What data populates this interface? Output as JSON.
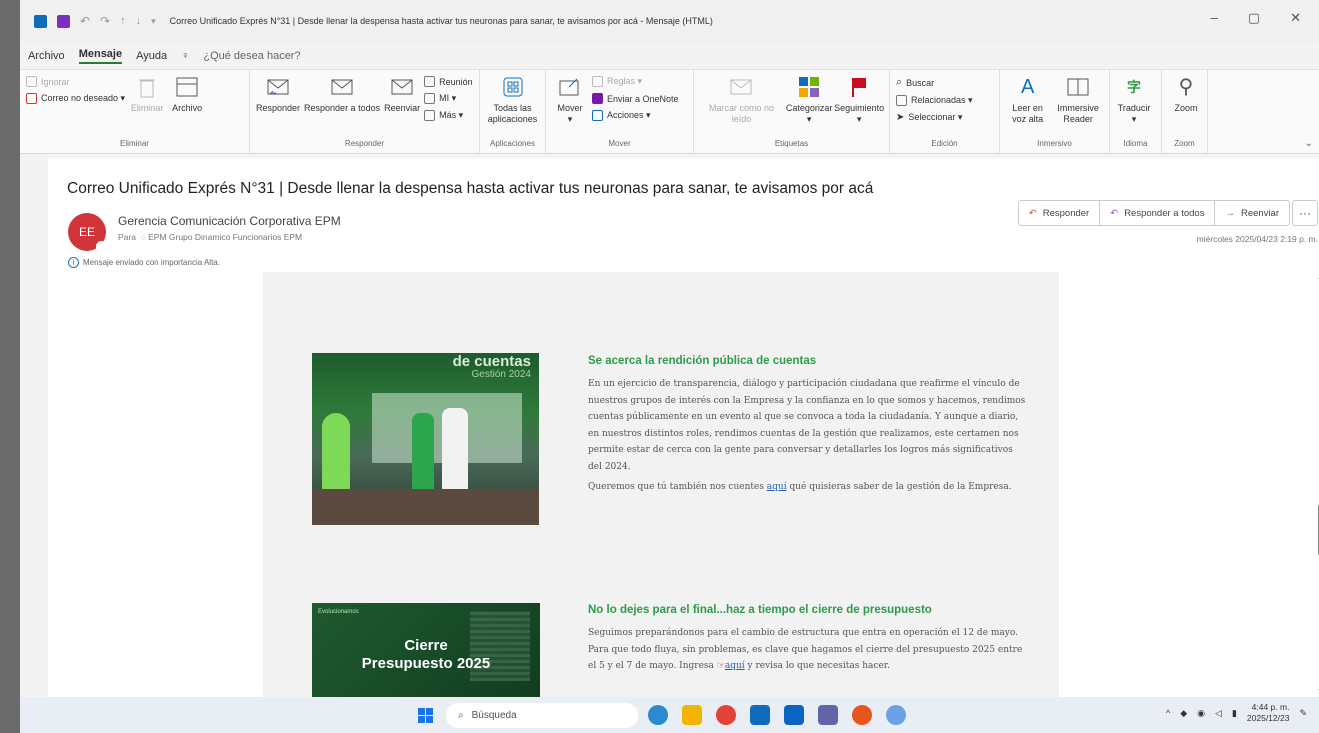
{
  "window": {
    "title": "Correo Unificado Exprés N°31 | Desde llenar la despensa hasta activar tus neuronas para sanar, te avisamos por acá  -  Mensaje (HTML)",
    "controls": {
      "minimize": "–",
      "restore": "▢",
      "close": "✕"
    }
  },
  "menu": {
    "items": [
      "Archivo",
      "Mensaje",
      "Ayuda"
    ],
    "active": "Mensaje",
    "tell_me": "¿Qué desea hacer?"
  },
  "ribbon": {
    "eliminar": {
      "label": "Eliminar",
      "ignorar": "Ignorar",
      "correo_no_deseado": "Correo no deseado ▾",
      "eliminar_btn": "Eliminar",
      "archivo": "Archivo"
    },
    "responder": {
      "label": "Responder",
      "responder": "Responder",
      "responder_todos": "Responder a todos",
      "reenviar": "Reenviar",
      "reunion": "Reunión",
      "mi": "MI ▾",
      "mas": "Más ▾"
    },
    "aplicaciones": {
      "label": "Aplicaciones",
      "todas": "Todas las aplicaciones"
    },
    "mover": {
      "label": "Mover",
      "mover": "Mover",
      "reglas": "Reglas ▾",
      "onenote": "Enviar a OneNote",
      "acciones": "Acciones ▾"
    },
    "etiquetas": {
      "label": "Etiquetas",
      "marcar": "Marcar como no leído",
      "categorizar": "Categorizar",
      "seguimiento": "Seguimiento"
    },
    "edicion": {
      "label": "Edición",
      "buscar": "Buscar",
      "relacionadas": "Relacionadas ▾",
      "seleccionar": "Seleccionar ▾"
    },
    "inmersivo": {
      "label": "Inmersivo",
      "leer": "Leer en voz alta",
      "immersive": "Immersive Reader"
    },
    "idioma": {
      "label": "Idioma",
      "traducir": "Traducir"
    },
    "zoom": {
      "label": "Zoom",
      "zoom": "Zoom"
    }
  },
  "message": {
    "subject": "Correo Unificado Exprés N°31 |  Desde llenar la despensa hasta activar tus neuronas para sanar, te avisamos por acá",
    "avatar_initials": "EE",
    "sender": "Gerencia Comunicación Corporativa EPM",
    "to_label": "Para",
    "to": "EPM Grupo Dinamico Funcionarios EPM",
    "importance": "Mensaje enviado con importancia Alta.",
    "date": "miércoles 2025/04/23 2:19 p. m.",
    "actions": {
      "reply": "Responder",
      "reply_all": "Responder a todos",
      "forward": "Reenviar",
      "more": "···"
    }
  },
  "body": {
    "article1": {
      "image_title": "de cuentas",
      "image_subtitle": "Gestión 2024",
      "heading": "Se acerca la rendición pública de cuentas",
      "p1": "En un ejercicio de transparencia, diálogo y participación ciudadana que reafirme el vínculo de nuestros grupos de interés con la Empresa y la confianza en lo que somos y hacemos, rendimos cuentas públicamente en un evento al que se convoca a toda la ciudadanía.  Y aunque a diario, en nuestros distintos roles, rendimos cuentas de la gestión que realizamos, este certamen nos permite estar de cerca con la gente para conversar y detallarles los logros más significativos del 2024.",
      "p2_before": "Queremos que tú también nos cuentes ",
      "p2_link": "aquí",
      "p2_after": " qué quisieras saber de la gestión de la Empresa."
    },
    "article2": {
      "image_tag": "Evolucionamos",
      "image_line1": "Cierre",
      "image_line2": "Presupuesto 2025",
      "heading": "No lo dejes para el final...haz a tiempo el cierre de presupuesto",
      "p1_before": "Seguimos preparándonos para el cambio de estructura que entra en operación el 12 de mayo.  Para que todo fluya, sin problemas, es clave que hagamos el cierre del presupuesto 2025 entre el 5 y el 7 de mayo. Ingresa ",
      "p1_link": "aquí",
      "p1_after": " y revisa lo que necesitas hacer."
    }
  },
  "taskbar": {
    "search_placeholder": "Búsqueda",
    "time": "4:44 p. m.",
    "date": "2025/12/23"
  },
  "colors": {
    "accent_green": "#2e9c4a",
    "avatar_red": "#d13438",
    "link_blue": "#2b5fb0"
  }
}
